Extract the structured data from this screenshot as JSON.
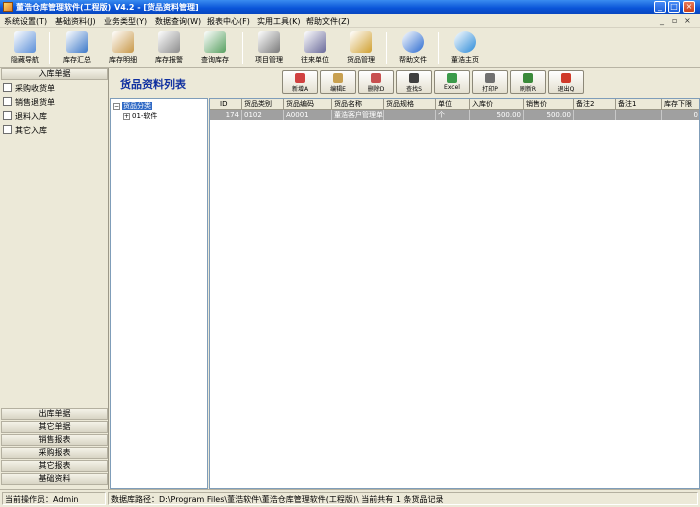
{
  "window": {
    "title": "董浩仓库管理软件(工程版) V4.2 - [货品资料管理]"
  },
  "menu": [
    "系统设置(T)",
    "基础资料(J)",
    "业务类型(Y)",
    "数据查询(W)",
    "报表中心(F)",
    "实用工具(K)",
    "帮助文件(Z)"
  ],
  "toolbar": [
    {
      "label": "隐藏导航",
      "icon": "navigation-icon",
      "color": "#5B8FD8"
    },
    {
      "label": "库存汇总",
      "icon": "pie-chart-icon",
      "color": "#3C78C8"
    },
    {
      "label": "库存明细",
      "icon": "box-icon",
      "color": "#C89848"
    },
    {
      "label": "库存报警",
      "icon": "alarm-icon",
      "color": "#8C8C8C"
    },
    {
      "label": "查询库存",
      "icon": "inventory-query-icon",
      "color": "#58A060"
    },
    {
      "label": "项目管理",
      "icon": "project-icon",
      "color": "#7A7A7A"
    },
    {
      "label": "往来单位",
      "icon": "contacts-icon",
      "color": "#6A6A9A"
    },
    {
      "label": "货品管理",
      "icon": "goods-icon",
      "color": "#D0A030"
    },
    {
      "label": "帮助文件",
      "icon": "help-icon",
      "color": "#2A6AD0"
    },
    {
      "label": "董浩主页",
      "icon": "homepage-icon",
      "color": "#2A8AD8"
    }
  ],
  "sidebar": {
    "top_header": "入库单据",
    "items": [
      "采购收货单",
      "销售退货单",
      "退料入库",
      "其它入库"
    ],
    "bottom_headers": [
      "出库单据",
      "其它单据",
      "销售报表",
      "采购报表",
      "其它报表",
      "基础资料"
    ]
  },
  "content": {
    "title": "货品资料列表",
    "buttons": [
      {
        "label": "新增A",
        "icon": "add-icon",
        "color": "#D04040"
      },
      {
        "label": "编辑E",
        "icon": "edit-icon",
        "color": "#C8A050"
      },
      {
        "label": "删除D",
        "icon": "delete-icon",
        "color": "#C85050"
      },
      {
        "label": "查找S",
        "icon": "find-icon",
        "color": "#404040"
      },
      {
        "label": "Excel",
        "icon": "excel-icon",
        "color": "#3A9A4A"
      },
      {
        "label": "打印P",
        "icon": "print-icon",
        "color": "#707070"
      },
      {
        "label": "刷新R",
        "icon": "refresh-icon",
        "color": "#3A8A3A"
      },
      {
        "label": "退出Q",
        "icon": "exit-icon",
        "color": "#D03A2A"
      }
    ]
  },
  "tree": {
    "root": "货品分类",
    "child": "01-软件"
  },
  "table": {
    "columns": [
      "ID",
      "货品类别",
      "货品编码",
      "货品名称",
      "货品规格",
      "单位",
      "入库价",
      "销售价",
      "备注2",
      "备注1",
      "库存下限"
    ],
    "rows": [
      [
        "174",
        "0102",
        "A0001",
        "董浩客户管理单机版",
        "",
        "个",
        "500.00",
        "500.00",
        "",
        "",
        "0"
      ]
    ]
  },
  "status": {
    "operator": "当前操作员：Admin",
    "path": "数据库路径：D:\\Program Files\\董浩软件\\董浩仓库管理软件(工程版)\\ 当前共有 1 条货品记录"
  }
}
